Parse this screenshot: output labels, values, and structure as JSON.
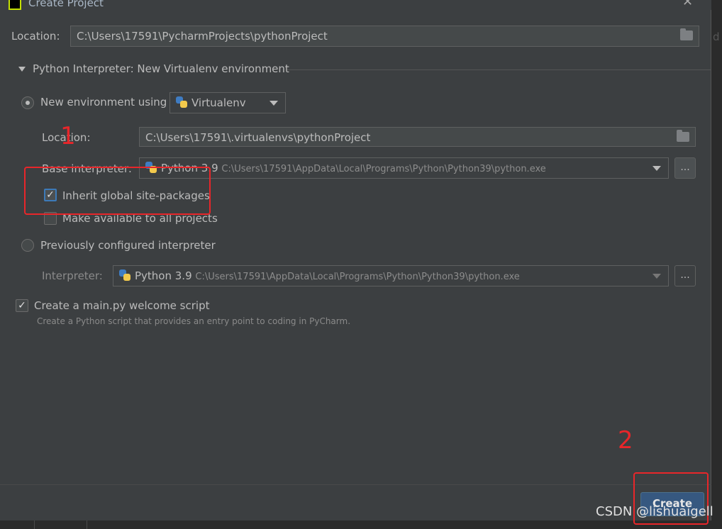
{
  "title": "Create Project",
  "location": {
    "label": "Location:",
    "value": "C:\\Users\\17591\\PycharmProjects\\pythonProject"
  },
  "interpreter_section": {
    "header": "Python Interpreter: New Virtualenv environment"
  },
  "new_env": {
    "radio_label": "New environment using",
    "tool": "Virtualenv",
    "location_label": "Location:",
    "location_value": "C:\\Users\\17591\\.virtualenvs\\pythonProject",
    "base_label": "Base interpreter:",
    "base_version": "Python 3.9",
    "base_path": "C:\\Users\\17591\\AppData\\Local\\Programs\\Python\\Python39\\python.exe",
    "inherit_label": "Inherit global site-packages",
    "inherit_checked": true,
    "available_label": "Make available to all projects",
    "available_checked": false
  },
  "previous": {
    "radio_label": "Previously configured interpreter",
    "interp_label": "Interpreter:",
    "version": "Python 3.9",
    "path": "C:\\Users\\17591\\AppData\\Local\\Programs\\Python\\Python39\\python.exe"
  },
  "welcome": {
    "label": "Create a main.py welcome script",
    "checked": true,
    "hint": "Create a Python script that provides an entry point to coding in PyCharm."
  },
  "buttons": {
    "create": "Create",
    "browse": "..."
  },
  "annotations": {
    "one": "1",
    "two": "2"
  },
  "watermark": "CSDN @lishuaigell",
  "background_fragment": "d",
  "colors": {
    "annotation": "#e8262a",
    "primary_button": "#365880",
    "dialog_bg": "#3c3f41"
  }
}
